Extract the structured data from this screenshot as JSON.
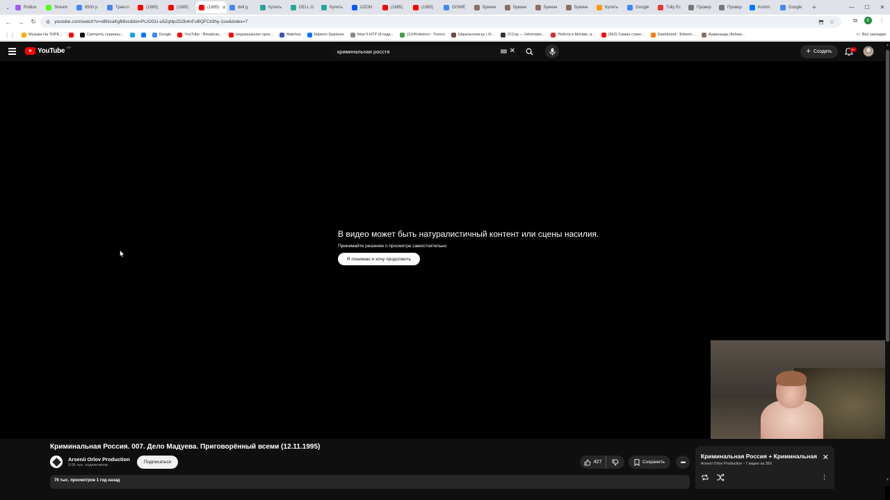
{
  "browser": {
    "tabs": [
      {
        "label": "Roblox",
        "color": "#a259ff"
      },
      {
        "label": "Stream",
        "color": "#53fc18"
      },
      {
        "label": "6500 р",
        "color": "#4285f4"
      },
      {
        "label": "Трансл",
        "color": "#4285f4"
      },
      {
        "label": "(1885)",
        "color": "#ff0000"
      },
      {
        "label": "(1885)",
        "color": "#ff0000"
      },
      {
        "label": "(1885)",
        "color": "#ff0000"
      },
      {
        "label": "dell g",
        "color": "#4285f4"
      },
      {
        "label": "Купить",
        "color": "#26a69a"
      },
      {
        "label": "DELL G",
        "color": "#26a69a"
      },
      {
        "label": "Купить",
        "color": "#26a69a"
      },
      {
        "label": "OZON",
        "color": "#005bff"
      },
      {
        "label": "(1885)",
        "color": "#ff0000"
      },
      {
        "label": "(1885)",
        "color": "#ff0000"
      },
      {
        "label": "GISME",
        "color": "#4285f4"
      },
      {
        "label": "Букинн",
        "color": "#8d6e63"
      },
      {
        "label": "Букинн",
        "color": "#8d6e63"
      },
      {
        "label": "Букинн",
        "color": "#8d6e63"
      },
      {
        "label": "Букинн",
        "color": "#8d6e63"
      },
      {
        "label": "Купить",
        "color": "#ff9800"
      },
      {
        "label": "Google",
        "color": "#4285f4"
      },
      {
        "label": "Tully Ес",
        "color": "#e53935"
      },
      {
        "label": "Провер",
        "color": "#777777"
      },
      {
        "label": "Провер",
        "color": "#777777"
      },
      {
        "label": "Komm",
        "color": "#0077ff"
      },
      {
        "label": "Google",
        "color": "#4285f4"
      }
    ],
    "active_tab_index": 6,
    "active_tab_label": "(1885)",
    "url": "youtube.com/watch?v=oBNcaKgB8vc&list=PLIOGU-u5ZqNp2DZb4nFoBQFCti3hy-1sw&index=7",
    "bookmarks": [
      {
        "label": "Музыка На ТОРЕ...",
        "color": "#f9ab00"
      },
      {
        "label": "",
        "color": "#ff0000"
      },
      {
        "label": "Смотреть сериалы...",
        "color": "#111111"
      },
      {
        "label": "",
        "color": "#1da1f2"
      },
      {
        "label": "",
        "color": "#0077ff"
      },
      {
        "label": "Google",
        "color": "#4285f4"
      },
      {
        "label": "YouTube - Broadcas...",
        "color": "#ff0000"
      },
      {
        "label": "Недоказанное прох...",
        "color": "#ff0000"
      },
      {
        "label": "Matches",
        "color": "#3f51b5"
      },
      {
        "label": "Кирилл Зыряное",
        "color": "#0077ff"
      },
      {
        "label": "Now 5-HTP (5-гидр...",
        "color": "#888888"
      },
      {
        "label": "(1)VKinkHoro - Troovo",
        "color": "#43a047"
      },
      {
        "label": "Шашлычник.ру | Vi...",
        "color": "#6d4c41"
      },
      {
        "label": "ICCup — Informatio...",
        "color": "#333333"
      },
      {
        "label": "Работа в Москве, в...",
        "color": "#d32f2f"
      },
      {
        "label": "(562) Самая стран...",
        "color": "#ff0000"
      },
      {
        "label": "Dashboard - Etherm...",
        "color": "#f57c00"
      },
      {
        "label": "Ашваганда (Ashwa...",
        "color": "#8d6e63"
      }
    ],
    "all_bookmarks_label": "Все закладки",
    "profile_letter": "K"
  },
  "youtube": {
    "logo_text": "YouTube",
    "region": "BY",
    "search_value": "криминальная росстя",
    "create_label": "Создать",
    "notifications_badge": "9+"
  },
  "player": {
    "warning_title": "В видео может быть натуралистичный контент или сцены насилия.",
    "warning_subtitle": "Принимайте решение о просмотре самостоятельно",
    "warning_button": "Я понимаю и хочу продолжить"
  },
  "video": {
    "title": "Криминальная Россия. 007. Дело Мадуева. Приговорённый всеми (12.11.1995)",
    "channel_name": "Arsenii Orlov Production",
    "subscribers": "9,06 тыс. подписчиков",
    "subscribe_label": "Подписаться",
    "likes": "427",
    "save_label": "Сохранить",
    "more_label": "•••",
    "views_and_date": "76 тыс. просмотров  1 год назад"
  },
  "playlist": {
    "title": "Криминальная Россия + Криминальная",
    "meta": "Arsenii Orlov Production - 7 видео из 350"
  }
}
